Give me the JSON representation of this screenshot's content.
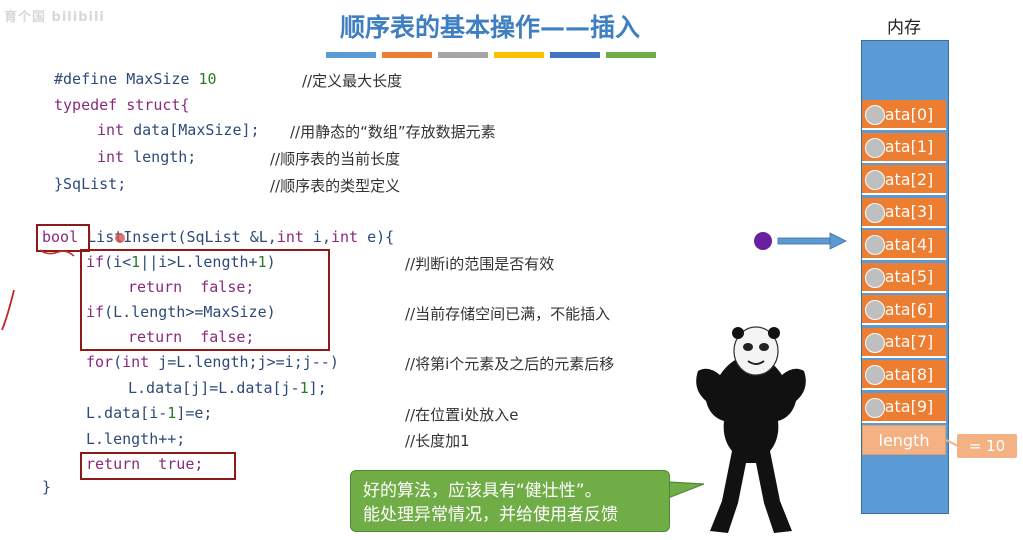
{
  "slide": {
    "title": "顺序表的基本操作——插入",
    "watermark": "育个国 bilibili",
    "color_bars": [
      "#5b9bd5",
      "#ed7d31",
      "#a5a5a5",
      "#ffc000",
      "#4472c4",
      "#70ad47"
    ]
  },
  "code": {
    "l1": [
      "#define MaxSize ",
      "10"
    ],
    "l1c": "//定义最大长度",
    "l2": [
      "typedef struct{"
    ],
    "l3": [
      "int",
      " data[MaxSize];"
    ],
    "l3c": "//用静态的“数组”存放数据元素",
    "l4": [
      "int",
      " length;"
    ],
    "l4c": "//顺序表的当前长度",
    "l5": [
      "}SqList;"
    ],
    "l5c": "//顺序表的类型定义",
    "l6": [
      "bool",
      " ListInsert(SqList &L,",
      "int",
      " i,",
      "int",
      " e){"
    ],
    "l7": [
      "if",
      "(i<",
      "1",
      "||i>L.length+",
      "1",
      ")"
    ],
    "l7c": "//判断i的范围是否有效",
    "l8": [
      "return",
      "  false;"
    ],
    "l9": [
      "if",
      "(L.length>=MaxSize)"
    ],
    "l9c": "//当前存储空间已满，不能插入",
    "l10": [
      "return",
      "  false;"
    ],
    "l11": [
      "for",
      "(",
      "int",
      " j=L.length;j>=i;j--)"
    ],
    "l11c": "//将第i个元素及之后的元素后移",
    "l12": [
      "L.data[j]=L.data[j-",
      "1",
      "];"
    ],
    "l13": [
      "L.data[i-",
      "1",
      "]=e;"
    ],
    "l13c": "//在位置i处放入e",
    "l14": [
      "L.length++;"
    ],
    "l14c": "//长度加1",
    "l15": [
      "return",
      "  true;"
    ],
    "l16": [
      "}"
    ]
  },
  "memory": {
    "title": "内存",
    "cells": [
      "ata[0]",
      "ata[1]",
      "ata[2]",
      "ata[3]",
      "ata[4]",
      "ata[5]",
      "ata[6]",
      "ata[7]",
      "ata[8]",
      "ata[9]"
    ],
    "length_label": "length",
    "length_value": "= 10"
  },
  "bubble": {
    "line1": "好的算法，应该具有“健壮性”。",
    "line2": "能处理异常情况，并给使用者反馈"
  }
}
